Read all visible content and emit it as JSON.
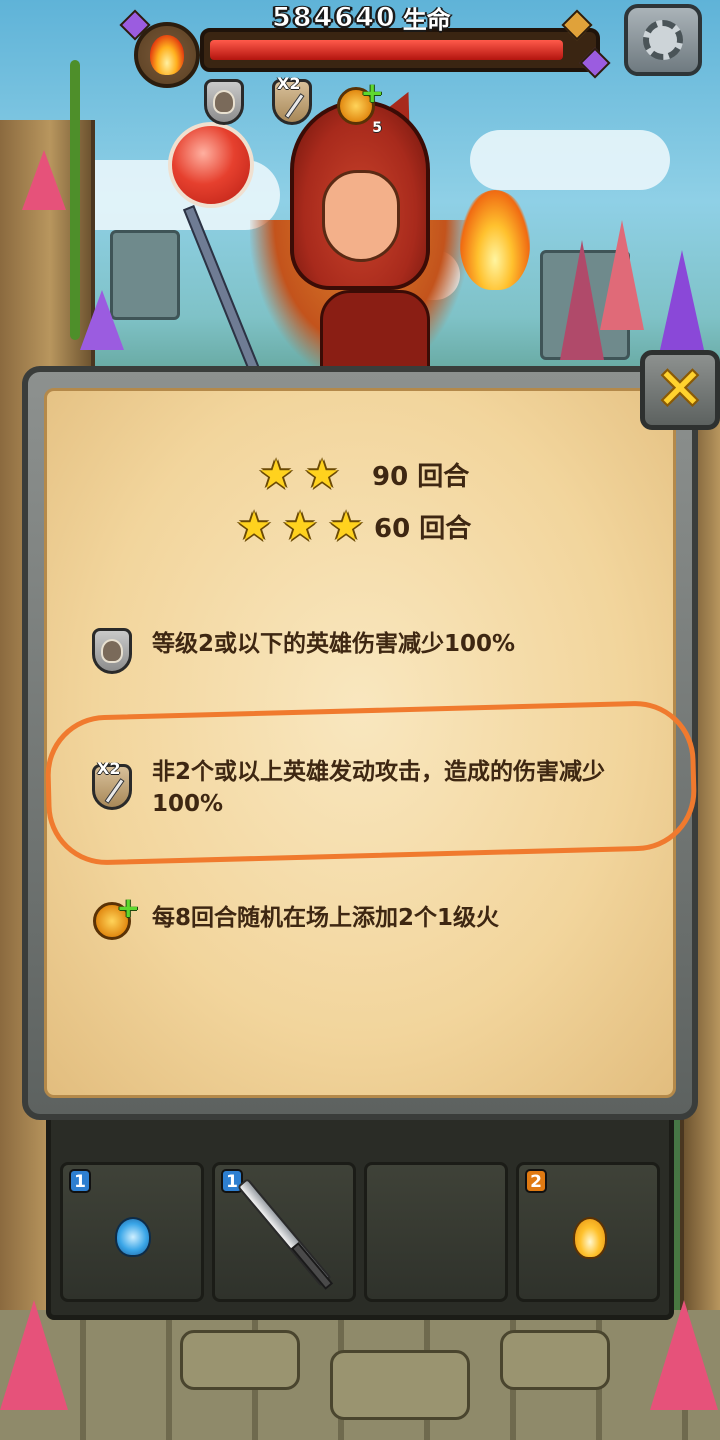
{
  "hud": {
    "boss_hp": "584640",
    "boss_hp_label": "生命",
    "boss_hp_fraction": 0.93,
    "boss_element_icon": "fire-icon",
    "modifier_icons": [
      {
        "icon": "shield-hero-icon"
      },
      {
        "icon": "shield-sword-x2-icon",
        "badge": "X2"
      },
      {
        "icon": "fire-coin-plus-icon",
        "count": "5"
      }
    ],
    "settings_icon": "gear-icon"
  },
  "dialog": {
    "close_icon": "close-icon",
    "close_glyph": "✕",
    "star_goals": [
      {
        "stars": 2,
        "text": "90 回合"
      },
      {
        "stars": 3,
        "text": "60 回合"
      }
    ],
    "rules": [
      {
        "icon": "shield-hero-icon",
        "text": "等级2或以下的英雄伤害减少100%"
      },
      {
        "icon": "shield-sword-x2-icon",
        "badge": "X2",
        "text": "非2个或以上英雄发动攻击，造成的伤害减少100%"
      },
      {
        "icon": "fire-coin-plus-icon",
        "badge": "+",
        "text": "每8回合随机在场上添加2个1级火"
      }
    ]
  },
  "board": {
    "tiles": [
      {
        "level": "1",
        "level_color": "#2e7fd0",
        "item": "ice-orb-icon"
      },
      {
        "level": "1",
        "level_color": "#2e7fd0",
        "item": "sword-icon"
      },
      {
        "level": "",
        "item": ""
      },
      {
        "level": "2",
        "level_color": "#e07a12",
        "item": "fire-orb-icon"
      }
    ]
  },
  "colors": {
    "text": "#3e2712",
    "highlight": "#f07a2e",
    "star": "#ffd21e",
    "hp": "#d8261a"
  }
}
